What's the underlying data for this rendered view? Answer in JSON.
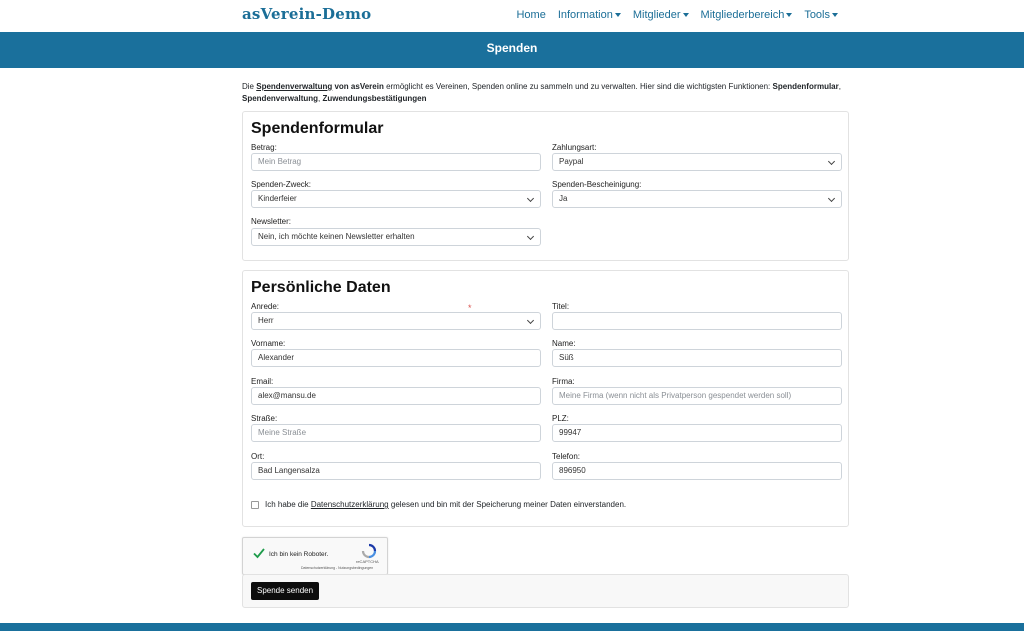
{
  "brand": "asVerein-Demo",
  "nav": {
    "home": "Home",
    "information": "Information",
    "mitglieder": "Mitglieder",
    "mitgliederbereich": "Mitgliederbereich",
    "tools": "Tools"
  },
  "hero_title": "Spenden",
  "intro": {
    "part1": "Die ",
    "link1": "Spendenverwaltung",
    "part2_bold": " von asVerein",
    "part3": " ermöglicht es Vereinen, Spenden online zu sammeln und zu verwalten. Hier sind die wichtigsten Funktionen: ",
    "f1": "Spendenformular",
    "sep1": ", ",
    "f2": "Spendenverwaltung",
    "sep2": ", ",
    "f3": "Zuwendungsbestätigungen"
  },
  "spendenformular": {
    "title": "Spendenformular",
    "betrag_label": "Betrag:",
    "betrag_placeholder": "Mein Betrag",
    "zahlungsart_label": "Zahlungsart:",
    "zahlungsart_value": "Paypal",
    "zweck_label": "Spenden-Zweck:",
    "zweck_value": "Kinderfeier",
    "bescheinigung_label": "Spenden-Bescheinigung:",
    "bescheinigung_value": "Ja",
    "newsletter_label": "Newsletter:",
    "newsletter_value": "Nein, ich möchte keinen Newsletter erhalten"
  },
  "persoenlich": {
    "title": "Persönliche Daten",
    "anrede_label": "Anrede:",
    "anrede_value": "Herr",
    "required_mark": "*",
    "titel_label": "Titel:",
    "titel_value": "",
    "vorname_label": "Vorname:",
    "vorname_value": "Alexander",
    "name_label": "Name:",
    "name_value": "Süß",
    "email_label": "Email:",
    "email_value": "alex@mansu.de",
    "firma_label": "Firma:",
    "firma_placeholder": "Meine Firma (wenn nicht als Privatperson gespendet werden soll)",
    "strasse_label": "Straße:",
    "strasse_placeholder": "Meine Straße",
    "plz_label": "PLZ:",
    "plz_value": "99947",
    "ort_label": "Ort:",
    "ort_value": "Bad Langensalza",
    "telefon_label": "Telefon:",
    "telefon_value": "896950",
    "consent_pre": "Ich habe die ",
    "consent_link": "Datenschutzerklärung",
    "consent_post": " gelesen und bin mit der Speicherung meiner Daten einverstanden."
  },
  "recaptcha": {
    "label": "Ich bin kein Roboter.",
    "brand": "reCAPTCHA",
    "terms": "Datenschutzerklärung - Nutzungsbedingungen"
  },
  "submit_label": "Spende senden",
  "colors": {
    "primary": "#1a709c",
    "brand_text": "#1b6e97"
  }
}
